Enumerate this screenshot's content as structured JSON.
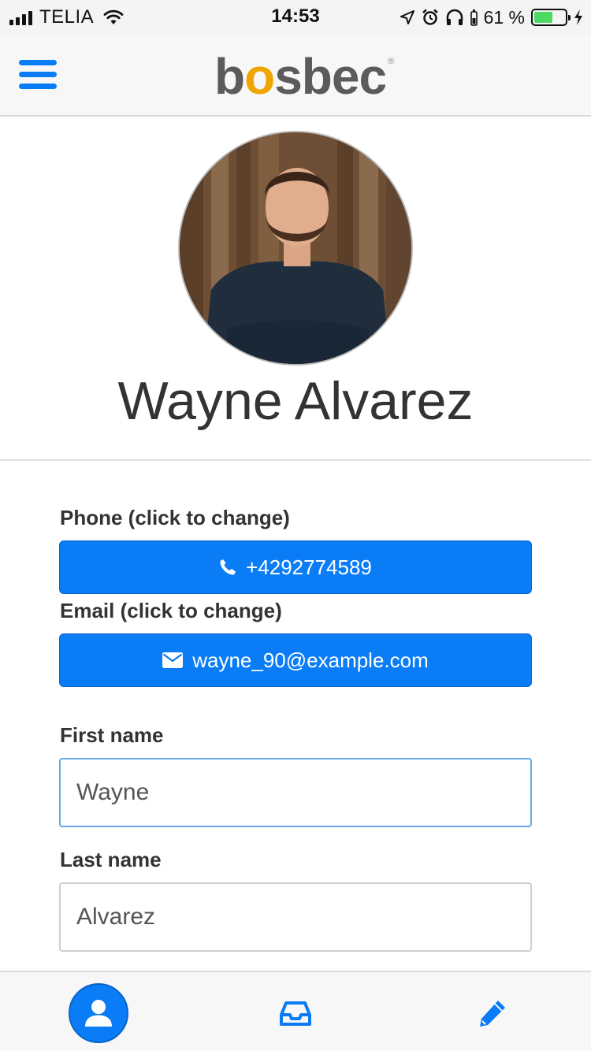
{
  "status_bar": {
    "carrier": "TELIA",
    "time": "14:53",
    "battery_percent": "61 %",
    "battery_level": 0.61
  },
  "header": {
    "logo": {
      "part1": "b",
      "o": "o",
      "part2": "sbec",
      "reg": "®"
    },
    "menu_icon": "hamburger-icon"
  },
  "profile": {
    "name": "Wayne Alvarez",
    "avatar_icon": "profile-photo"
  },
  "form": {
    "phone": {
      "label": "Phone (click to change)",
      "value": "+4292774589",
      "icon": "phone-icon"
    },
    "email": {
      "label": "Email (click to change)",
      "value": "wayne_90@example.com",
      "icon": "envelope-icon"
    },
    "first_name": {
      "label": "First name",
      "value": "Wayne"
    },
    "last_name": {
      "label": "Last name",
      "value": "Alvarez"
    }
  },
  "bottom_nav": {
    "tabs": [
      {
        "icon": "user-icon",
        "active": true
      },
      {
        "icon": "inbox-icon",
        "active": false
      },
      {
        "icon": "pencil-icon",
        "active": false
      }
    ]
  },
  "colors": {
    "accent": "#0a7cf6",
    "logo_o": "#f0a500",
    "battery": "#4cd964"
  }
}
